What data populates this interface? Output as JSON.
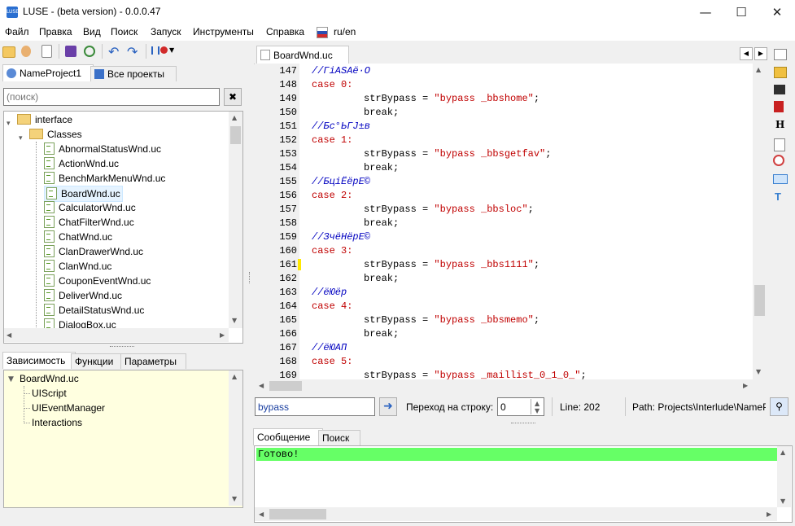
{
  "window": {
    "title": "LUSE - (beta version) - 0.0.0.47",
    "icon_text": "LUSE"
  },
  "menu": [
    "Файл",
    "Правка",
    "Вид",
    "Поиск",
    "Запуск",
    "Инструменты",
    "Справка",
    "ru/en"
  ],
  "project_tabs": [
    "NameProject1",
    "Все проекты"
  ],
  "search": {
    "placeholder": "(поиск)"
  },
  "tree": [
    {
      "label": "interface",
      "type": "folder",
      "level": 0
    },
    {
      "label": "Classes",
      "type": "folder",
      "level": 1
    },
    {
      "label": "AbnormalStatusWnd.uc",
      "type": "file",
      "level": 2
    },
    {
      "label": "ActionWnd.uc",
      "type": "file",
      "level": 2
    },
    {
      "label": "BenchMarkMenuWnd.uc",
      "type": "file",
      "level": 2
    },
    {
      "label": "BoardWnd.uc",
      "type": "file",
      "level": 2,
      "selected": true
    },
    {
      "label": "CalculatorWnd.uc",
      "type": "file",
      "level": 2
    },
    {
      "label": "ChatFilterWnd.uc",
      "type": "file",
      "level": 2
    },
    {
      "label": "ChatWnd.uc",
      "type": "file",
      "level": 2
    },
    {
      "label": "ClanDrawerWnd.uc",
      "type": "file",
      "level": 2
    },
    {
      "label": "ClanWnd.uc",
      "type": "file",
      "level": 2
    },
    {
      "label": "CouponEventWnd.uc",
      "type": "file",
      "level": 2
    },
    {
      "label": "DeliverWnd.uc",
      "type": "file",
      "level": 2
    },
    {
      "label": "DetailStatusWnd.uc",
      "type": "file",
      "level": 2
    },
    {
      "label": "DialogBox.uc",
      "type": "file",
      "level": 2
    }
  ],
  "bottom_tabs": [
    "Зависимость",
    "Функции",
    "Параметры"
  ],
  "deps": {
    "root": "BoardWnd.uc",
    "children": [
      "UIScript",
      "UIEventManager",
      "Interactions"
    ]
  },
  "editor_tab": "BoardWnd.uc",
  "code_lines": [
    {
      "n": "147",
      "indent": 8,
      "parts": [
        {
          "t": "//ГіАЅАё·О",
          "c": "com"
        }
      ]
    },
    {
      "n": "148",
      "indent": 8,
      "parts": [
        {
          "t": "case ",
          "c": "kw"
        },
        {
          "t": "0:",
          "c": "kw"
        }
      ]
    },
    {
      "n": "149",
      "indent": 16,
      "parts": [
        {
          "t": "strBypass = ",
          "c": ""
        },
        {
          "t": "\"bypass _bbshome\"",
          "c": "str"
        },
        {
          "t": ";",
          "c": ""
        }
      ]
    },
    {
      "n": "150",
      "indent": 16,
      "parts": [
        {
          "t": "break",
          "c": ""
        },
        {
          "t": ";",
          "c": ""
        }
      ]
    },
    {
      "n": "151",
      "indent": 8,
      "parts": [
        {
          "t": "//Бс°ЬГЈ±в",
          "c": "com"
        }
      ]
    },
    {
      "n": "152",
      "indent": 8,
      "parts": [
        {
          "t": "case ",
          "c": "kw"
        },
        {
          "t": "1:",
          "c": "kw"
        }
      ]
    },
    {
      "n": "153",
      "indent": 16,
      "parts": [
        {
          "t": "strBypass = ",
          "c": ""
        },
        {
          "t": "\"bypass _bbsgetfav\"",
          "c": "str"
        },
        {
          "t": ";",
          "c": ""
        }
      ]
    },
    {
      "n": "154",
      "indent": 16,
      "parts": [
        {
          "t": "break",
          "c": ""
        },
        {
          "t": ";",
          "c": ""
        }
      ]
    },
    {
      "n": "155",
      "indent": 8,
      "parts": [
        {
          "t": "//БціЁёрЕ©",
          "c": "com"
        }
      ]
    },
    {
      "n": "156",
      "indent": 8,
      "parts": [
        {
          "t": "case ",
          "c": "kw"
        },
        {
          "t": "2:",
          "c": "kw"
        }
      ]
    },
    {
      "n": "157",
      "indent": 16,
      "parts": [
        {
          "t": "strBypass = ",
          "c": ""
        },
        {
          "t": "\"bypass _bbsloc\"",
          "c": "str"
        },
        {
          "t": ";",
          "c": ""
        }
      ]
    },
    {
      "n": "158",
      "indent": 16,
      "parts": [
        {
          "t": "break",
          "c": ""
        },
        {
          "t": ";",
          "c": ""
        }
      ]
    },
    {
      "n": "159",
      "indent": 8,
      "parts": [
        {
          "t": "//ЗчёНёрЕ©",
          "c": "com"
        }
      ]
    },
    {
      "n": "160",
      "indent": 8,
      "parts": [
        {
          "t": "case ",
          "c": "kw"
        },
        {
          "t": "3:",
          "c": "kw"
        }
      ]
    },
    {
      "n": "161",
      "indent": 16,
      "parts": [
        {
          "t": "strBypass = ",
          "c": ""
        },
        {
          "t": "\"bypass _bbs1111\"",
          "c": "str"
        },
        {
          "t": ";",
          "c": ""
        }
      ]
    },
    {
      "n": "162",
      "indent": 16,
      "parts": [
        {
          "t": "break",
          "c": ""
        },
        {
          "t": ";",
          "c": ""
        }
      ]
    },
    {
      "n": "163",
      "indent": 8,
      "parts": [
        {
          "t": "//ёЮёр",
          "c": "com"
        }
      ]
    },
    {
      "n": "164",
      "indent": 8,
      "parts": [
        {
          "t": "case ",
          "c": "kw"
        },
        {
          "t": "4:",
          "c": "kw"
        }
      ]
    },
    {
      "n": "165",
      "indent": 16,
      "parts": [
        {
          "t": "strBypass = ",
          "c": ""
        },
        {
          "t": "\"bypass _bbsmemo\"",
          "c": "str"
        },
        {
          "t": ";",
          "c": ""
        }
      ]
    },
    {
      "n": "166",
      "indent": 16,
      "parts": [
        {
          "t": "break",
          "c": ""
        },
        {
          "t": ";",
          "c": ""
        }
      ]
    },
    {
      "n": "167",
      "indent": 8,
      "parts": [
        {
          "t": "//ёЮАП",
          "c": "com"
        }
      ]
    },
    {
      "n": "168",
      "indent": 8,
      "parts": [
        {
          "t": "case ",
          "c": "kw"
        },
        {
          "t": "5:",
          "c": "kw"
        }
      ]
    },
    {
      "n": "169",
      "indent": 16,
      "parts": [
        {
          "t": "strBypass = ",
          "c": ""
        },
        {
          "t": "\"bypass _maillist_0_1_0_\"",
          "c": "str"
        },
        {
          "t": ";",
          "c": ""
        }
      ]
    }
  ],
  "find": {
    "value": "bypass"
  },
  "goto": {
    "label": "Переход на строку:",
    "value": "0"
  },
  "status": {
    "line": "Line: 202",
    "path": "Path: Projects\\Interlude\\NameP"
  },
  "message_tabs": [
    "Сообщение",
    "Поиск"
  ],
  "message": "Готово!",
  "colors": {
    "ready_bg": "#66ff66",
    "deps_bg": "#ffffe0",
    "selected_bg": "#e5f3ff",
    "modified_marker": "#ffe800"
  }
}
